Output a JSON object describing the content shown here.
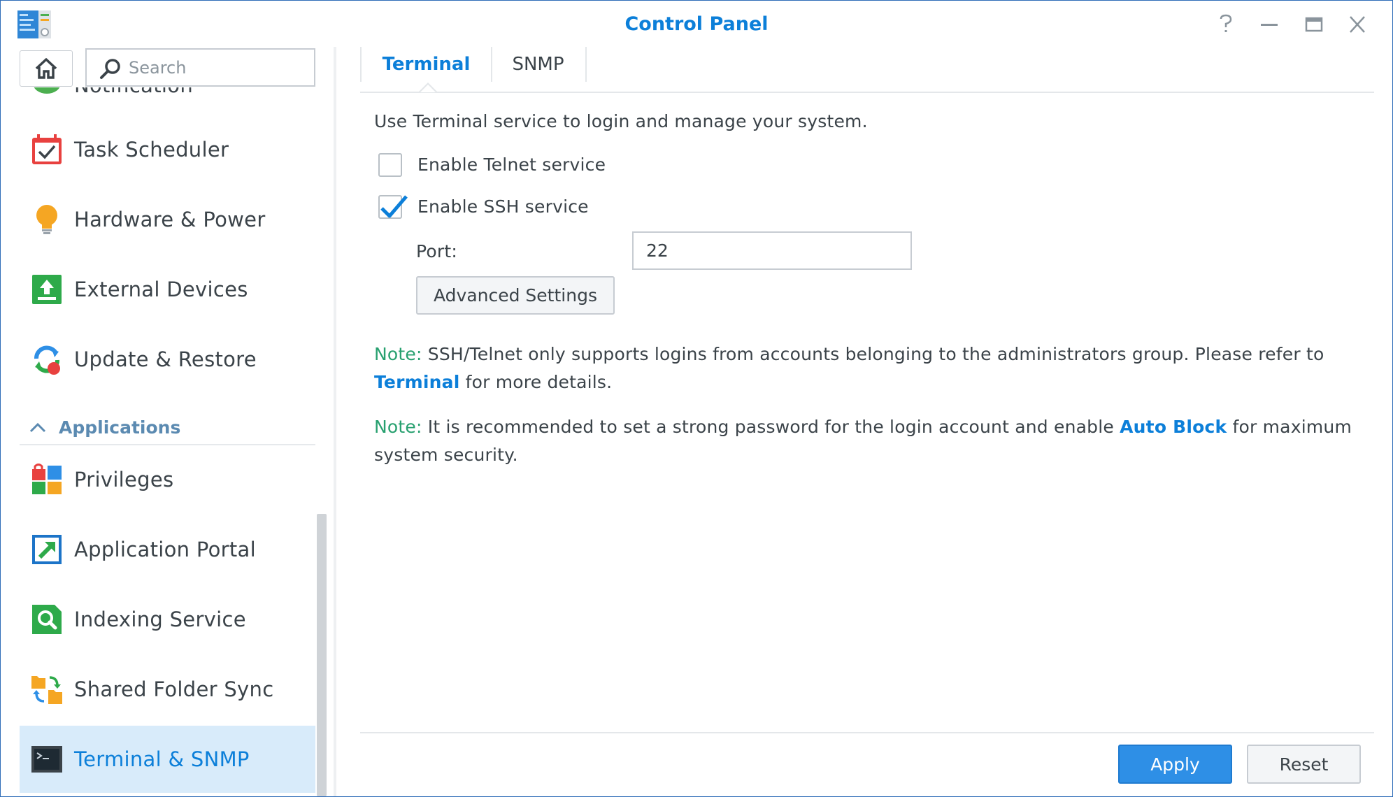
{
  "window": {
    "title": "Control Panel",
    "controls": [
      "help-icon",
      "minimize-icon",
      "maximize-icon",
      "close-icon"
    ]
  },
  "sidebar": {
    "search_placeholder": "Search",
    "partial_item": {
      "label": "Notification",
      "icon": "notification-icon"
    },
    "items": [
      {
        "label": "Task Scheduler",
        "icon": "task-scheduler-icon"
      },
      {
        "label": "Hardware & Power",
        "icon": "lightbulb-icon"
      },
      {
        "label": "External Devices",
        "icon": "external-devices-icon"
      },
      {
        "label": "Update & Restore",
        "icon": "update-restore-icon"
      }
    ],
    "section": {
      "label": "Applications",
      "expanded": true
    },
    "app_items": [
      {
        "label": "Privileges",
        "icon": "privileges-icon"
      },
      {
        "label": "Application Portal",
        "icon": "application-portal-icon"
      },
      {
        "label": "Indexing Service",
        "icon": "indexing-service-icon"
      },
      {
        "label": "Shared Folder Sync",
        "icon": "shared-folder-sync-icon"
      },
      {
        "label": "Terminal & SNMP",
        "icon": "terminal-icon",
        "active": true
      }
    ]
  },
  "tabs": [
    {
      "label": "Terminal",
      "active": true
    },
    {
      "label": "SNMP",
      "active": false
    }
  ],
  "terminal": {
    "intro": "Use Terminal service to login and manage your system.",
    "telnet": {
      "label": "Enable Telnet service",
      "checked": false
    },
    "ssh": {
      "label": "Enable SSH service",
      "checked": true
    },
    "port_label": "Port:",
    "port_value": "22",
    "advanced_label": "Advanced Settings",
    "note1": {
      "tag": "Note:",
      "text_before": " SSH/Telnet only supports logins from accounts belonging to the administrators group. Please refer to ",
      "link": "Terminal",
      "text_after": " for more details."
    },
    "note2": {
      "tag": "Note:",
      "text_before": " It is recommended to set a strong password for the login account and enable ",
      "link": "Auto Block",
      "text_after": " for maximum system security."
    }
  },
  "footer": {
    "apply_label": "Apply",
    "reset_label": "Reset"
  },
  "colors": {
    "accent": "#0c7fd9",
    "note": "#27a06f",
    "active_bg": "#d8ebfa",
    "apply_bg": "#2e8fe6"
  }
}
